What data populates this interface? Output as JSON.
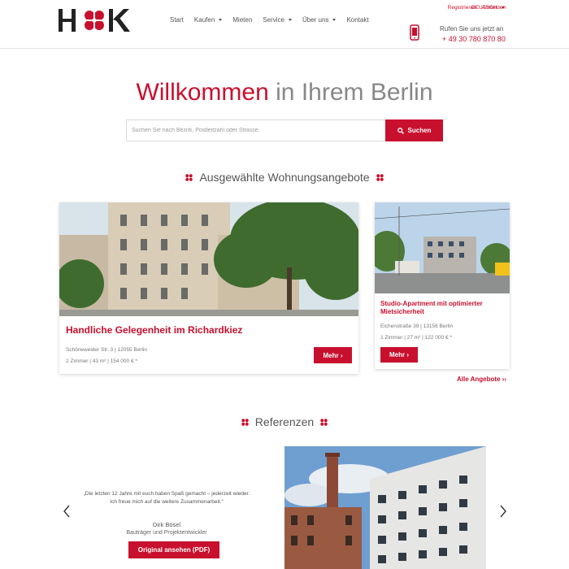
{
  "header": {
    "nav": [
      {
        "label": "Start",
        "has_dropdown": false
      },
      {
        "label": "Kaufen",
        "has_dropdown": true
      },
      {
        "label": "Mieten",
        "has_dropdown": false
      },
      {
        "label": "Service",
        "has_dropdown": true
      },
      {
        "label": "Über uns",
        "has_dropdown": true
      },
      {
        "label": "Kontakt",
        "has_dropdown": false
      }
    ],
    "register_label": "Registrieren",
    "login_label": "Anmelden",
    "language": "DEUTSCH",
    "call_label": "Rufen Sie uns jetzt an",
    "phone_number": "+ 49 30 780 870 80"
  },
  "hero": {
    "title_accent": "Willkommen",
    "title_rest": " in Ihrem Berlin",
    "search_placeholder": "Suchen Sie nach Bezirk, Postleitzahl oder Strasse",
    "search_button": "Suchen"
  },
  "offers": {
    "section_title": "Ausgewählte Wohnungsangebote",
    "cards": [
      {
        "title": "Handliche Gelegenheit im Richardkiez",
        "address": "Schöneweider Str. 3 | 12055 Berlin",
        "facts": "2 Zimmer  | 43 m²  | 154 000 € *",
        "button": "Mehr ›"
      },
      {
        "title": "Studio-Apartment mit optimierter Mietsicherheit",
        "address": "Eichenstraße 39 | 13156 Berlin",
        "facts": "1 Zimmer  | 27 m²  | 122 000 € *",
        "button": "Mehr ›"
      }
    ],
    "all_offers_label": "Alle Angebote ››"
  },
  "references": {
    "section_title": "Referenzen",
    "quote": "„Die letzten 12 Jahre mit euch haben Spaß gemacht – jederzeit wieder. Ich freue mich auf die weitere Zusammenarbeit.“",
    "name": "Dirk Bösel",
    "role": "Bauträger und Projektentwickler",
    "pdf_button": "Original ansehen (PDF)"
  },
  "colors": {
    "accent": "#c8102e",
    "text": "#555555",
    "logo_dark": "#222222"
  }
}
